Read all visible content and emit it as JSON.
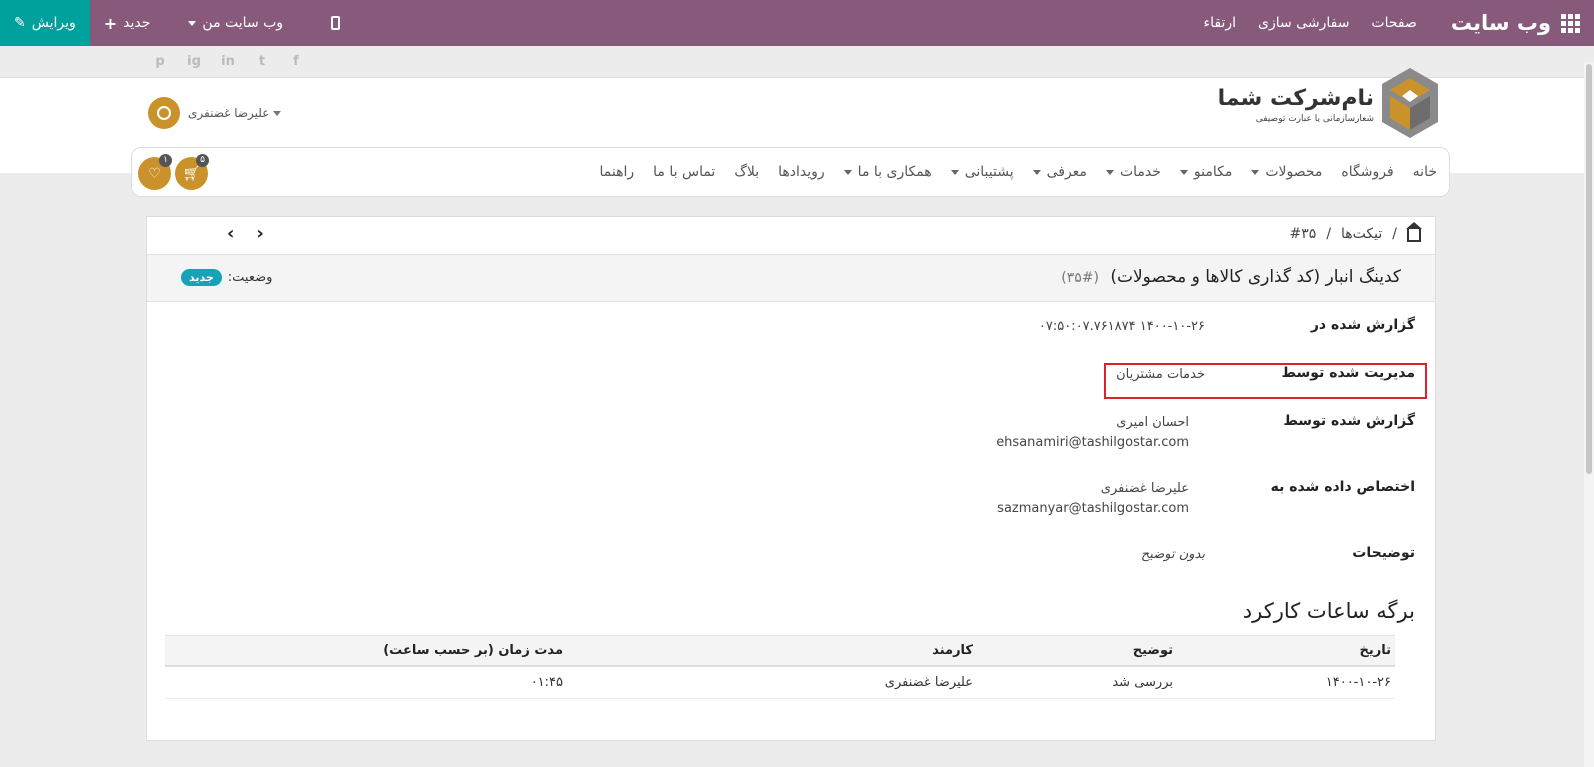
{
  "topbar": {
    "brand": "وب سایت",
    "menu": [
      "صفحات",
      "سفارشی سازی",
      "ارتقاء"
    ],
    "my_website": "وب سایت من",
    "new_label": "جدید",
    "edit_label": "ویرایش"
  },
  "social": [
    "f",
    "t",
    "in",
    "ig",
    "p"
  ],
  "logo": {
    "name": "نام‌شرکت شما",
    "slogan": "شعارسازمانی یا عبارت توصیفی"
  },
  "user": {
    "name": "علیرضا غضنفری"
  },
  "nav": {
    "items": [
      {
        "label": "خانه",
        "dropdown": false
      },
      {
        "label": "فروشگاه",
        "dropdown": false
      },
      {
        "label": "محصولات",
        "dropdown": true
      },
      {
        "label": "مکامنو",
        "dropdown": true
      },
      {
        "label": "خدمات",
        "dropdown": true
      },
      {
        "label": "معرفی",
        "dropdown": true
      },
      {
        "label": "پشتیبانی",
        "dropdown": true
      },
      {
        "label": "همکاری با ما",
        "dropdown": true
      },
      {
        "label": "رویدادها",
        "dropdown": false
      },
      {
        "label": "بلاگ",
        "dropdown": false
      },
      {
        "label": "تماس با ما",
        "dropdown": false
      },
      {
        "label": "راهنما",
        "dropdown": false
      }
    ],
    "cart_count": "۵",
    "wishlist_count": "۱"
  },
  "breadcrumb": {
    "tickets": "تیکت‌ها",
    "current": "#۳۵"
  },
  "ticket": {
    "title": "کدینگ انبار (کد گذاری کالاها و محصولات)",
    "number": "(#۳۵)",
    "status_label": "وضعیت:",
    "status_value": "جدید"
  },
  "fields": {
    "reported_on_label": "گزارش شده در",
    "reported_on_value": "۱۴۰۰-۱۰-۲۶ ۰۷:۵۰:۰۷.۷۶۱۸۷۴",
    "managed_by_label": "مدیریت شده توسط",
    "managed_by_value": "خدمات مشتریان",
    "reported_by_label": "گزارش شده توسط",
    "reported_by_name": "احسان امیری",
    "reported_by_email": "ehsanamiri@tashilgostar.com",
    "assigned_to_label": "اختصاص داده شده به",
    "assigned_to_name": "علیرضا غضنفری",
    "assigned_to_email": "sazmanyar@tashilgostar.com",
    "description_label": "توضیحات",
    "description_value": "بدون توضیح"
  },
  "timesheet": {
    "title": "برگه ساعات کارکرد",
    "headers": [
      "تاریخ",
      "توضیح",
      "کارمند",
      "مدت زمان (بر حسب ساعت)"
    ],
    "rows": [
      [
        "۱۴۰۰-۱۰-۲۶",
        "بررسی شد",
        "علیرضا غضنفری",
        "۰۱:۴۵"
      ]
    ]
  },
  "colors": {
    "topbar": "#875a7b",
    "edit": "#00a09d",
    "accent": "#c9922a",
    "highlight": "#e0202a"
  }
}
